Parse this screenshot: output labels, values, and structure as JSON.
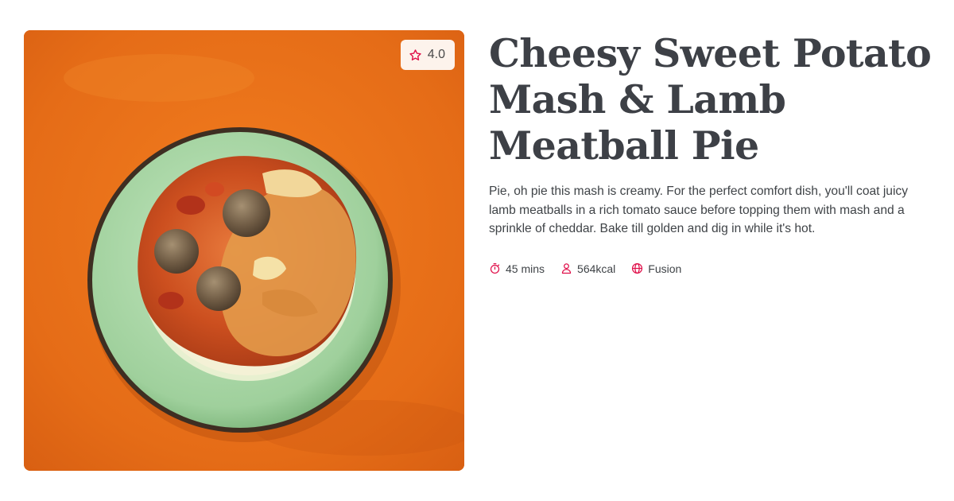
{
  "recipe": {
    "title": "Cheesy Sweet Potato Mash & Lamb Meatball Pie",
    "description": "Pie, oh pie this mash is creamy. For the perfect comfort dish, you'll coat juicy lamb meatballs in a rich tomato sauce before topping them with mash and a sprinkle of cheddar. Bake till golden and dig in while it's hot.",
    "rating": "4.0",
    "meta": {
      "time": "45 mins",
      "calories": "564kcal",
      "cuisine": "Fusion"
    }
  },
  "icons": {
    "rating": "star-icon",
    "time": "timer-icon",
    "calories": "person-icon",
    "cuisine": "globe-icon"
  },
  "colors": {
    "accent": "#e0114b",
    "title": "#3d4046",
    "body_text": "#3f4347",
    "badge_bg": "#fdf3ec",
    "image_background": "#e8701c"
  }
}
